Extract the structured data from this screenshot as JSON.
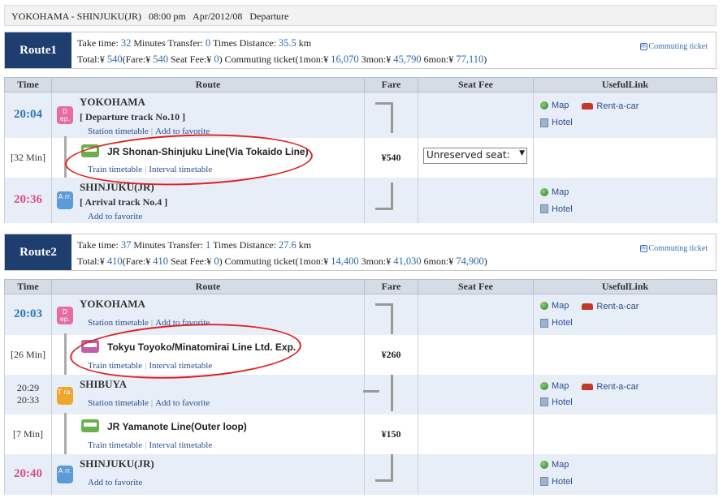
{
  "header": {
    "route": "YOKOHAMA - SHINJUKU(JR)",
    "time": "08:00 pm",
    "date": "Apr/2012/08",
    "mode": "Departure"
  },
  "common": {
    "commuting": "Commuting ticket",
    "col_time": "Time",
    "col_route": "Route",
    "col_fare": "Fare",
    "col_seat": "Seat Fee",
    "col_links": "UsefulLink",
    "station_tt": "Station timetable",
    "add_fav": "Add to favorite",
    "train_tt": "Train timetable",
    "interval_tt": "Interval timetable",
    "map": "Map",
    "rent": "Rent-a-car",
    "hotel": "Hotel",
    "badge_dep": "D ep.",
    "badge_arr": "A rr.",
    "badge_tra": "T ra."
  },
  "route1": {
    "label": "Route1",
    "line1": {
      "t1": "Take time: ",
      "v1": "32",
      "t2": " Minutes  Transfer: ",
      "v2": "0",
      "t3": " Times  Distance: ",
      "v3": "35.5",
      "t4": " km"
    },
    "line2": {
      "a": "Total:¥ ",
      "b": "540",
      "c": "(Fare:¥ ",
      "d": "540",
      "e": "  Seat Fee:¥ ",
      "f": "0",
      "g": ")  Commuting ticket(1mon:¥ ",
      "h": "16,070",
      "i": "  3mon:¥ ",
      "j": "45,790",
      "k": "  6mon:¥ ",
      "l": "77,110",
      "m": ")"
    },
    "dep_time": "20:04",
    "dep_station": "YOKOHAMA",
    "dep_track": "[ Departure track No.10 ]",
    "duration": "[32 Min]",
    "line": "JR Shonan-Shinjuku Line(Via Tokaido Line)",
    "fare": "¥540",
    "seat": "Unreserved seat: ",
    "arr_time": "20:36",
    "arr_station": "SHINJUKU(JR)",
    "arr_track": "[ Arrival track No.4 ]"
  },
  "route2": {
    "label": "Route2",
    "line1": {
      "t1": "Take time: ",
      "v1": "37",
      "t2": " Minutes  Transfer: ",
      "v2": "1",
      "t3": " Times  Distance: ",
      "v3": "27.6",
      "t4": " km"
    },
    "line2": {
      "a": "Total:¥ ",
      "b": "410",
      "c": "(Fare:¥ ",
      "d": "410",
      "e": "  Seat Fee:¥ ",
      "f": "0",
      "g": ")  Commuting ticket(1mon:¥ ",
      "h": "14,400",
      "i": "  3mon:¥ ",
      "j": "41,030",
      "k": "  6mon:¥ ",
      "l": "74,900",
      "m": ")"
    },
    "dep_time": "20:03",
    "dep_station": "YOKOHAMA",
    "duration1": "[26 Min]",
    "line1_name": "Tokyu Toyoko/Minatomirai Line Ltd. Exp.",
    "fare1": "¥260",
    "tr_time_a": "20:29",
    "tr_time_b": "20:33",
    "tr_station": "SHIBUYA",
    "duration2": "[7 Min]",
    "line2_name": "JR Yamanote Line(Outer loop)",
    "fare2": "¥150",
    "arr_time": "20:40",
    "arr_station": "SHINJUKU(JR)"
  },
  "colors": {
    "route_label": "#1e3e70",
    "dep_time": "#2f78b6",
    "arr_time": "#d64f88",
    "annotation": "#e02020"
  }
}
